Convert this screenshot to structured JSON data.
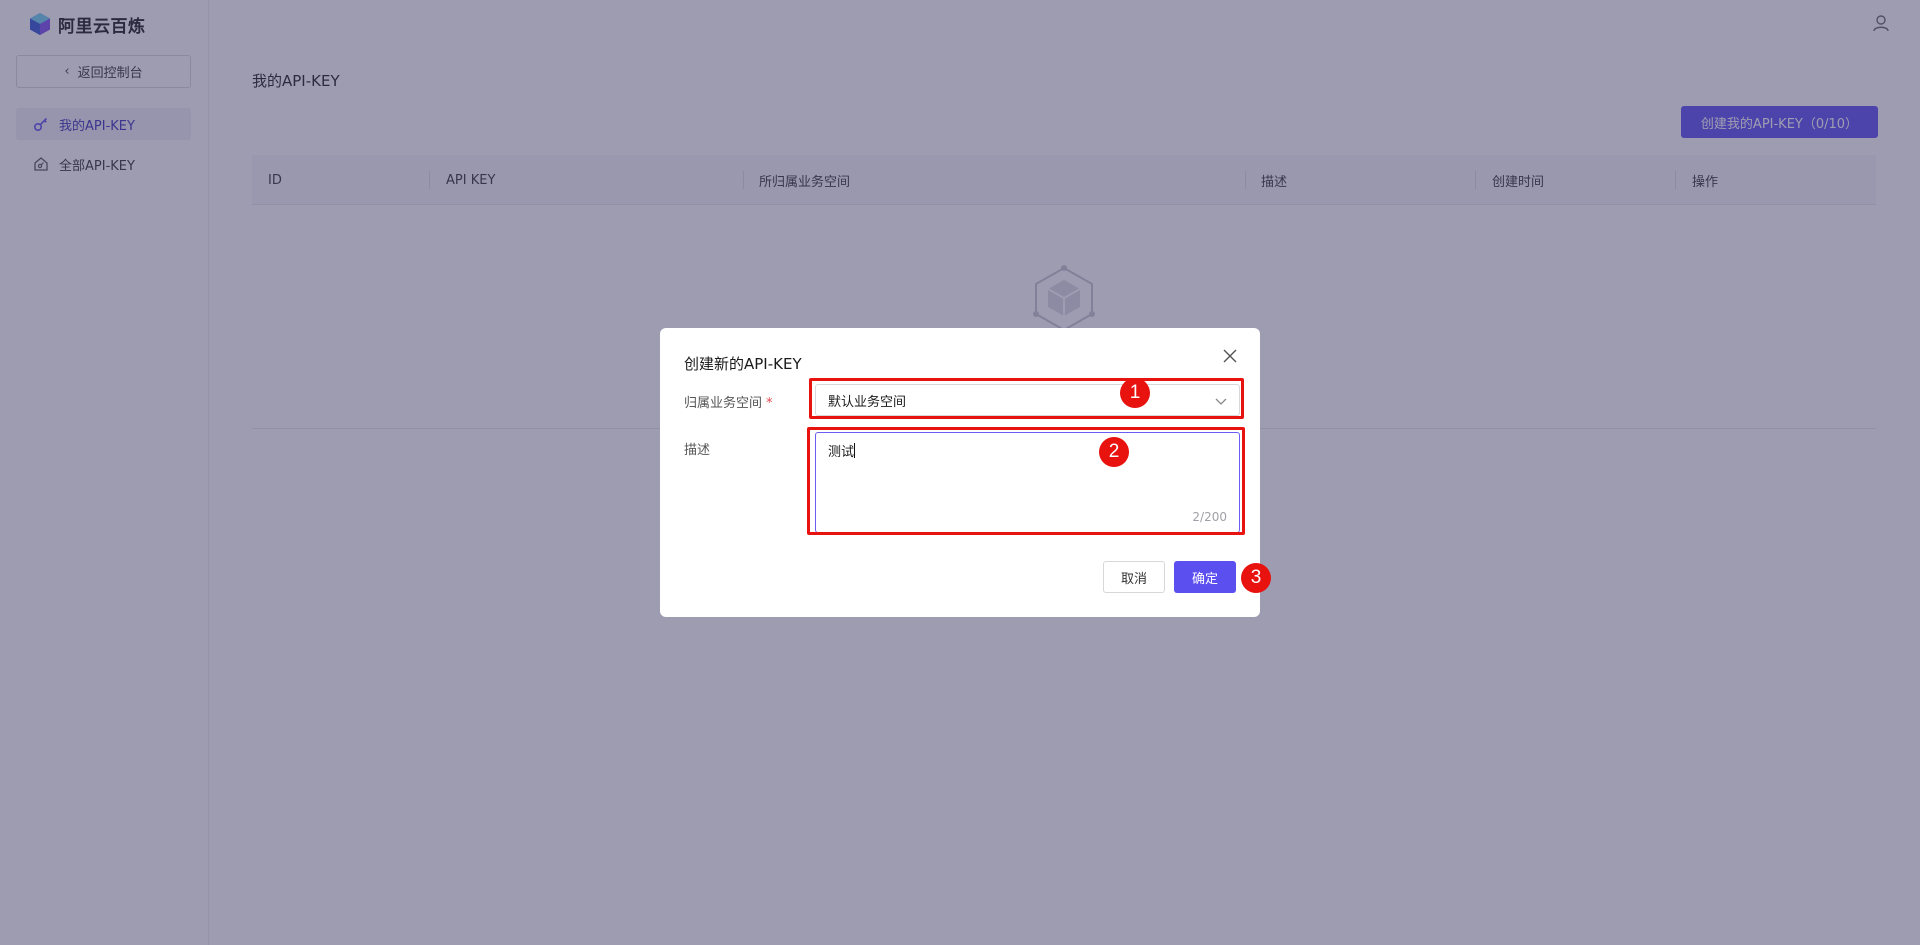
{
  "app": {
    "name": "阿里云百炼"
  },
  "sidebar": {
    "back_label": "返回控制台",
    "items": [
      {
        "label": "我的API-KEY",
        "icon": "key-icon",
        "active": true
      },
      {
        "label": "全部API-KEY",
        "icon": "home-key-icon",
        "active": false
      }
    ]
  },
  "main": {
    "title": "我的API-KEY",
    "create_button": "创建我的API-KEY（0/10）",
    "columns": [
      "ID",
      "API KEY",
      "所归属业务空间",
      "描述",
      "创建时间",
      "操作"
    ]
  },
  "dialog": {
    "title": "创建新的API-KEY",
    "workspace_label": "归属业务空间",
    "workspace_required_mark": "*",
    "workspace_value": "默认业务空间",
    "description_label": "描述",
    "description_value": "测试",
    "description_counter": "2/200",
    "cancel_label": "取消",
    "ok_label": "确定"
  },
  "annotations": [
    "1",
    "2",
    "3"
  ],
  "colors": {
    "primary": "#5b4ff0",
    "annotation": "#e8120f",
    "overlay": "rgba(62,58,100,0.5)"
  }
}
